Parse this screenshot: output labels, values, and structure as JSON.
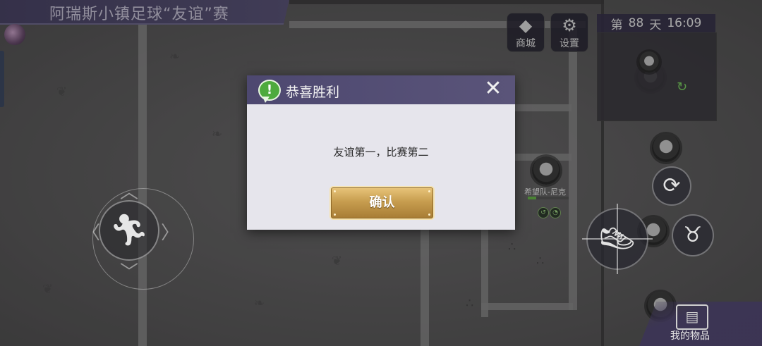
{
  "match": {
    "title": "阿瑞斯小镇足球“友谊”赛"
  },
  "top_buttons": {
    "shop": {
      "label": "商城",
      "icon": "diamond-icon"
    },
    "settings": {
      "label": "设置",
      "icon": "gear-icon"
    }
  },
  "clock": {
    "day_prefix": "第",
    "day": "88",
    "day_suffix": "天",
    "time": "16:09"
  },
  "character": {
    "name": "希望队-尼克",
    "health": 0.2
  },
  "inventory": {
    "label": "我的物品"
  },
  "dialog": {
    "title": "恭喜胜利",
    "message": "友谊第一，比赛第二",
    "confirm_label": "确认"
  },
  "colors": {
    "header": "#4d4870",
    "dialog_bg": "#e6e5ec",
    "confirm_gold": "#c79d4f",
    "speech_green": "#4eaa3e"
  }
}
